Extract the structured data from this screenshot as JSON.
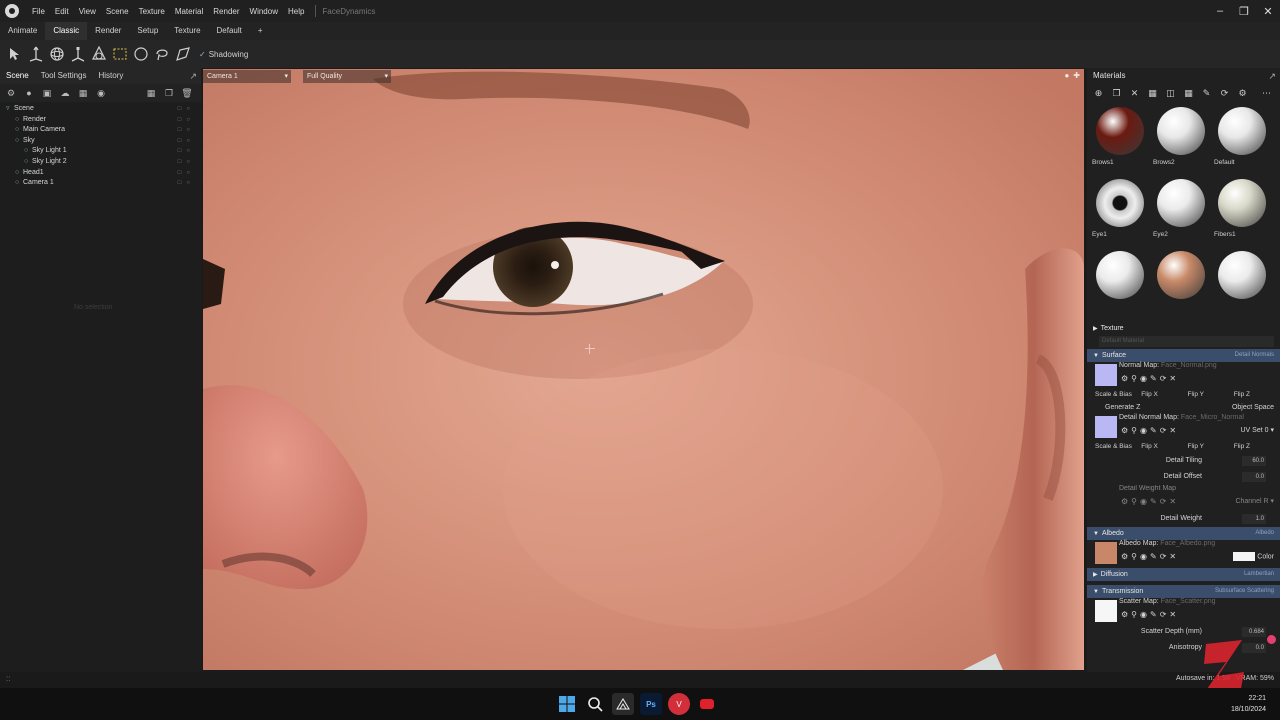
{
  "menubar": {
    "items": [
      "File",
      "Edit",
      "View",
      "Scene",
      "Texture",
      "Material",
      "Render",
      "Window",
      "Help"
    ],
    "title": "FaceDynamics"
  },
  "workspaces": {
    "tabs": [
      "Animate",
      "Classic",
      "Render",
      "Setup",
      "Texture",
      "Default"
    ],
    "active": "Classic",
    "add_label": "+"
  },
  "toolbar": {
    "shadowing_label": "Shadowing",
    "tools": [
      "select-arrow-icon",
      "move-gizmo-icon",
      "rotate-gizmo-icon",
      "scale-gizmo-icon",
      "universal-gizmo-icon",
      "rect-select-icon",
      "circle-select-icon",
      "lasso-select-icon",
      "paint-select-icon"
    ]
  },
  "left_panel": {
    "tabs": [
      "Scene",
      "Tool Settings",
      "History"
    ],
    "tree": [
      {
        "label": "Scene",
        "depth": 0
      },
      {
        "label": "Render",
        "depth": 1
      },
      {
        "label": "Main Camera",
        "depth": 1
      },
      {
        "label": "Sky",
        "depth": 1
      },
      {
        "label": "Sky Light 1",
        "depth": 2
      },
      {
        "label": "Sky Light 2",
        "depth": 2
      },
      {
        "label": "Head1",
        "depth": 1
      },
      {
        "label": "Camera 1",
        "depth": 1
      }
    ],
    "placeholder": "No selection"
  },
  "viewport": {
    "camera": "Camera 1",
    "quality": "Full Quality"
  },
  "materials": {
    "title": "Materials",
    "thumbs": [
      {
        "label": "Brows1",
        "color": "#6b1a10"
      },
      {
        "label": "Brows2",
        "color": "#e8e8e8"
      },
      {
        "label": "Default",
        "color": "#e8e8e8"
      },
      {
        "label": "Eye1",
        "color": "#9e9e9e"
      },
      {
        "label": "Eye2",
        "color": "#ebebeb"
      },
      {
        "label": "Fibers1",
        "color": "#d8d8c8"
      },
      {
        "label": "",
        "color": "#ebebeb"
      },
      {
        "label": "",
        "color": "#c88a68"
      },
      {
        "label": "",
        "color": "#ebebeb"
      }
    ],
    "texture_header": "Texture",
    "texture_field": "Default Material",
    "surface_header": "Surface",
    "surface_right": "Detail Normals",
    "normal_map_label": "Normal Map:",
    "normal_map_file": "Face_Normal.png",
    "scale_bias": "Scale & Bias",
    "flip_x": "Flip X",
    "flip_y": "Flip Y",
    "flip_z": "Flip Z",
    "generate_z": "Generate Z",
    "object_space": "Object Space",
    "detail_normal_label": "Detail Normal Map:",
    "detail_normal_file": "Face_Micro_Normal",
    "uv_set_label": "UV Set",
    "uv_set_value": "0",
    "detail_tiling_label": "Detail Tiling",
    "detail_tiling_value": "60.0",
    "detail_offset_label": "Detail Offset",
    "detail_offset_value": "0.0",
    "detail_weight_map_label": "Detail Weight Map",
    "channel_label": "Channel",
    "channel_value": "R",
    "detail_weight_label": "Detail Weight",
    "detail_weight_value": "1.0",
    "albedo_header": "Albedo",
    "albedo_right": "Albedo",
    "albedo_map_label": "Albedo Map:",
    "albedo_map_file": "Face_Albedo.png",
    "color_label": "Color",
    "diffusion_header": "Diffusion",
    "diffusion_right": "Lambertian",
    "transmission_header": "Transmission",
    "transmission_right": "Subsurface Scattering",
    "scatter_map_label": "Scatter Map:",
    "scatter_map_file": "Face_Scatter.png",
    "scatter_depth_label": "Scatter Depth (mm)",
    "scatter_depth_value": "0.684",
    "anisotropy_label": "Anisotropy",
    "anisotropy_value": "0.0"
  },
  "status": {
    "left": "::",
    "autosave": "Autosave in: 1:58",
    "vram": "VRAM: 59%"
  },
  "taskbar": {
    "time": "22:21",
    "date": "18/10/2024",
    "apps": [
      "windows-start-icon",
      "search-icon",
      "photo-app-icon",
      "photoshop-icon",
      "vivaldi-icon",
      "record-icon"
    ]
  },
  "colors": {
    "accent_blue": "#3a4e6c",
    "skin": "#d2917a",
    "pink_dot": "#e33f6f",
    "z_logo": "#d9232d"
  }
}
